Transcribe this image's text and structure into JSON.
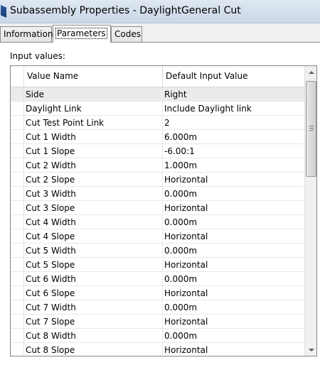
{
  "window": {
    "title": "Subassembly Properties - DaylightGeneral Cut"
  },
  "tabs": [
    {
      "label": "Information",
      "active": false
    },
    {
      "label": "Parameters",
      "active": true
    },
    {
      "label": "Codes",
      "active": false
    }
  ],
  "panel": {
    "section_label": "Input values:"
  },
  "grid": {
    "columns": [
      "Value Name",
      "Default Input Value"
    ],
    "selected_row": 0,
    "rows": [
      {
        "name": "Side",
        "value": "Right"
      },
      {
        "name": "Daylight Link",
        "value": "Include Daylight link"
      },
      {
        "name": "Cut Test Point Link",
        "value": "2"
      },
      {
        "name": "Cut 1 Width",
        "value": "6.000m"
      },
      {
        "name": "Cut 1 Slope",
        "value": "-6.00:1"
      },
      {
        "name": "Cut 2 Width",
        "value": "1.000m"
      },
      {
        "name": "Cut 2 Slope",
        "value": "Horizontal"
      },
      {
        "name": "Cut 3 Width",
        "value": "0.000m"
      },
      {
        "name": "Cut 3 Slope",
        "value": "Horizontal"
      },
      {
        "name": "Cut 4 Width",
        "value": "0.000m"
      },
      {
        "name": "Cut 4 Slope",
        "value": "Horizontal"
      },
      {
        "name": "Cut 5 Width",
        "value": "0.000m"
      },
      {
        "name": "Cut 5 Slope",
        "value": "Horizontal"
      },
      {
        "name": "Cut 6 Width",
        "value": "0.000m"
      },
      {
        "name": "Cut 6 Slope",
        "value": "Horizontal"
      },
      {
        "name": "Cut 7 Width",
        "value": "0.000m"
      },
      {
        "name": "Cut 7 Slope",
        "value": "Horizontal"
      },
      {
        "name": "Cut 8 Width",
        "value": "0.000m"
      },
      {
        "name": "Cut 8 Slope",
        "value": "Horizontal"
      }
    ]
  },
  "icons": {
    "app": "autodesk-app-icon",
    "scroll_up": "scroll-up-arrow-icon",
    "scroll_down": "scroll-down-arrow-icon",
    "thumb_grip": "scroll-grip-icon"
  }
}
